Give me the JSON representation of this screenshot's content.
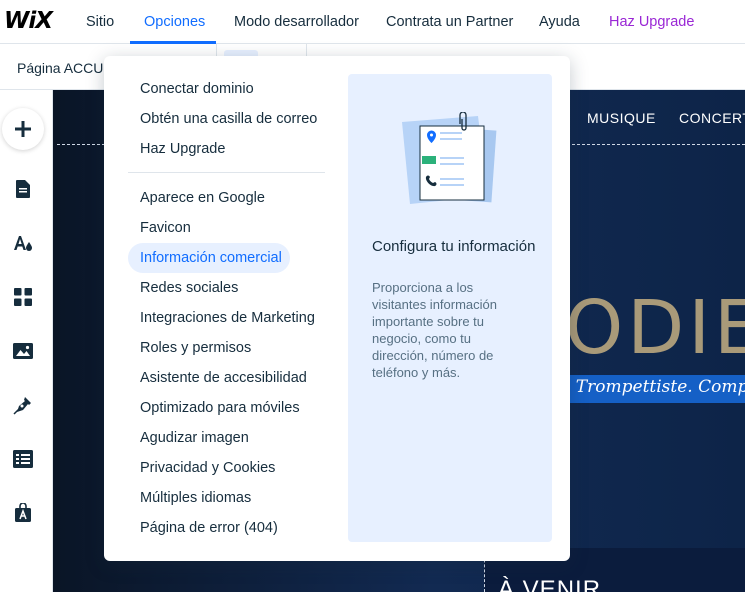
{
  "topbar": {
    "logo": "WiX",
    "menu": [
      "Sitio",
      "Opciones",
      "Modo desarrollador",
      "Contrata un Partner",
      "Ayuda",
      "Haz Upgrade"
    ],
    "active_menu": "Opciones",
    "accent_color": "#116dff",
    "upgrade_color": "#9a27d5"
  },
  "subbar": {
    "page_label": "Página",
    "page_name": "ACCUE"
  },
  "leftbar": {
    "icons": [
      "add-icon",
      "pages-icon",
      "design-icon",
      "apps-icon",
      "media-icon",
      "pen-icon",
      "table-icon",
      "bag-icon"
    ]
  },
  "dropdown": {
    "group1": [
      "Conectar dominio",
      "Obtén una casilla de correo",
      "Haz Upgrade"
    ],
    "group2": [
      "Aparece en Google",
      "Favicon",
      "Información comercial",
      "Redes sociales",
      "Integraciones de Marketing",
      "Roles y permisos",
      "Asistente de accesibilidad",
      "Optimizado para móviles",
      "Agudizar imagen",
      "Privacidad y Cookies",
      "Múltiples idiomas",
      "Página de error (404)"
    ],
    "highlighted": "Información comercial",
    "panel": {
      "title": "Configura tu información",
      "description": "Proporciona a los visitantes información importante sobre tu negocio, como tu dirección, número de teléfono y más."
    }
  },
  "site": {
    "nav": [
      "MUSIQUE",
      "CONCERTS"
    ],
    "title": "ODIE",
    "tagline": ". Trompettiste. Compos",
    "section": "À VENIR"
  }
}
